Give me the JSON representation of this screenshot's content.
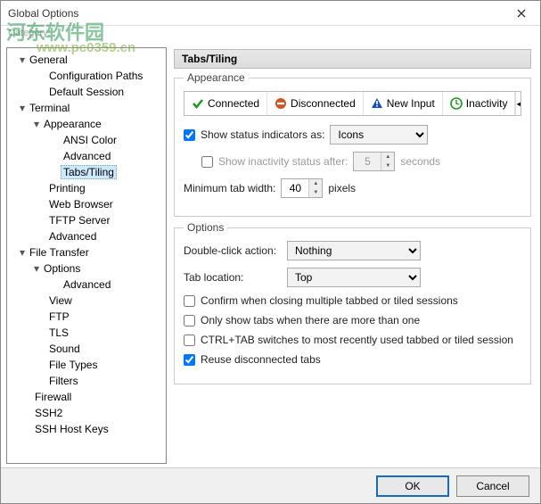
{
  "window": {
    "title": "Global Options",
    "category_label": "Category:"
  },
  "watermark": {
    "main": "河东软件园",
    "sub": "www.pc0359.cn"
  },
  "tree": {
    "general": {
      "label": "General",
      "children": {
        "config_paths": "Configuration Paths",
        "default_session": "Default Session"
      }
    },
    "terminal": {
      "label": "Terminal",
      "appearance": {
        "label": "Appearance",
        "ansi": "ANSI Color",
        "advanced": "Advanced",
        "tabs": "Tabs/Tiling"
      },
      "printing": "Printing",
      "web": "Web Browser",
      "tftp": "TFTP Server",
      "advanced": "Advanced"
    },
    "ft": {
      "label": "File Transfer",
      "options": {
        "label": "Options",
        "advanced": "Advanced"
      },
      "view": "View",
      "ftp": "FTP",
      "tls": "TLS",
      "sound": "Sound",
      "filetypes": "File Types",
      "filters": "Filters"
    },
    "firewall": "Firewall",
    "ssh2": "SSH2",
    "hostkeys": "SSH Host Keys"
  },
  "page": {
    "title": "Tabs/Tiling",
    "appearance": {
      "title": "Appearance",
      "statuses": {
        "connected": "Connected",
        "disconnected": "Disconnected",
        "newinput": "New Input",
        "inactivity": "Inactivity"
      },
      "show_status": {
        "label": "Show status indicators as:",
        "value": "Icons",
        "checked": true
      },
      "inactivity": {
        "label": "Show inactivity status after:",
        "value": "5",
        "unit": "seconds",
        "checked": false
      },
      "minwidth": {
        "label": "Minimum tab width:",
        "value": "40",
        "unit": "pixels"
      }
    },
    "options": {
      "title": "Options",
      "dblclick": {
        "label": "Double-click action:",
        "value": "Nothing"
      },
      "tabloc": {
        "label": "Tab location:",
        "value": "Top"
      },
      "cb1": {
        "label": "Confirm when closing multiple tabbed or tiled sessions",
        "checked": false
      },
      "cb2": {
        "label": "Only show tabs when there are more than one",
        "checked": false
      },
      "cb3": {
        "label": "CTRL+TAB switches to most recently used tabbed or tiled session",
        "checked": false
      },
      "cb4": {
        "label": "Reuse disconnected tabs",
        "checked": true
      }
    }
  },
  "buttons": {
    "ok": "OK",
    "cancel": "Cancel"
  }
}
